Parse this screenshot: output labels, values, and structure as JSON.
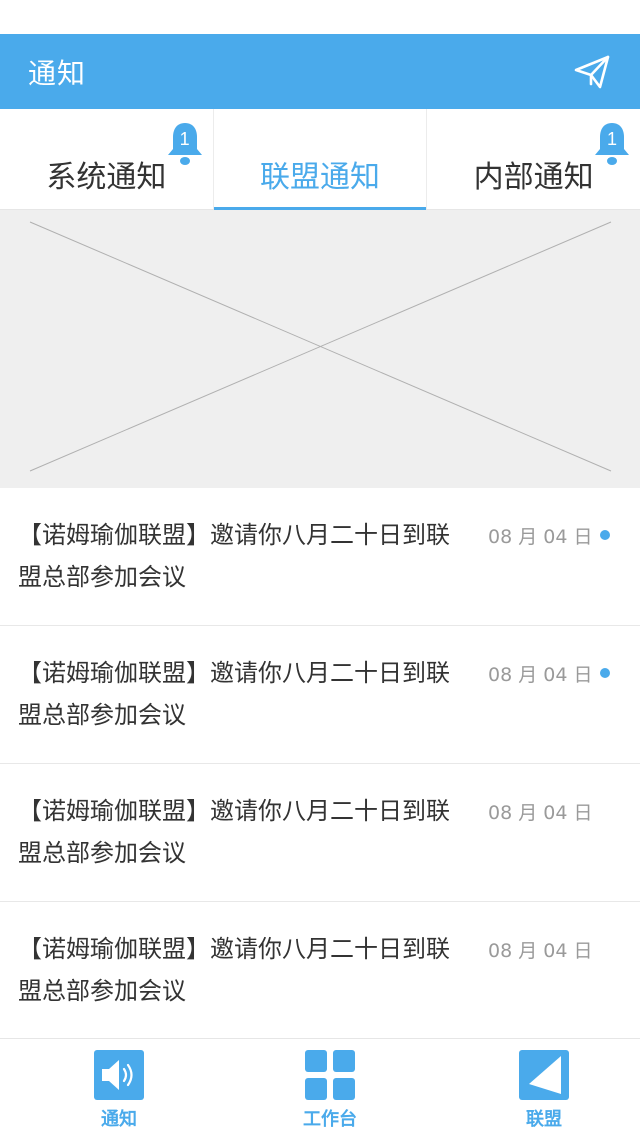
{
  "header": {
    "title": "通知"
  },
  "tabs": [
    {
      "label": "系统通知",
      "badge": "1",
      "active": false
    },
    {
      "label": "联盟通知",
      "badge": "",
      "active": true
    },
    {
      "label": "内部通知",
      "badge": "1",
      "active": false
    }
  ],
  "notices": [
    {
      "title": "【诺姆瑜伽联盟】邀请你八月二十日到联盟总部参加会议",
      "date": "08 月 04 日",
      "unread": true
    },
    {
      "title": "【诺姆瑜伽联盟】邀请你八月二十日到联盟总部参加会议",
      "date": "08 月 04 日",
      "unread": true
    },
    {
      "title": "【诺姆瑜伽联盟】邀请你八月二十日到联盟总部参加会议",
      "date": "08 月 04 日",
      "unread": false
    },
    {
      "title": "【诺姆瑜伽联盟】邀请你八月二十日到联盟总部参加会议",
      "date": "08 月 04 日",
      "unread": false
    }
  ],
  "bottom_nav": [
    {
      "label": "通知",
      "icon": "speaker-icon"
    },
    {
      "label": "工作台",
      "icon": "grid-icon"
    },
    {
      "label": "联盟",
      "icon": "triangle-icon"
    }
  ],
  "colors": {
    "accent": "#4aaaeb",
    "text": "#333333",
    "muted": "#9a9a9a",
    "placeholder_bg": "#efefef"
  }
}
